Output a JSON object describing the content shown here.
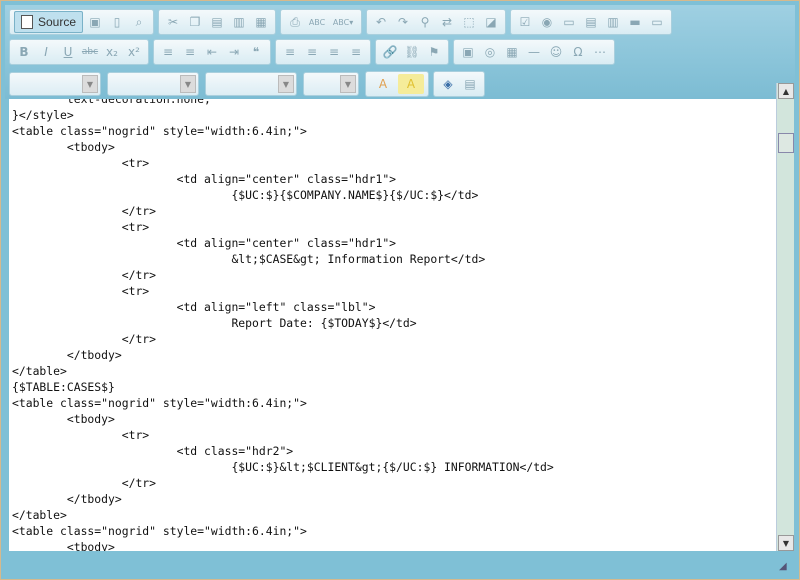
{
  "toolbar": {
    "source_label": "Source",
    "row1_icons": [
      "save-icon",
      "new-page-icon",
      "preview-icon",
      "cut-icon",
      "copy-icon",
      "paste-icon",
      "paste-text-icon",
      "paste-word-icon",
      "print-icon",
      "spellcheck-icon",
      "spellcheck-dropdown-icon",
      "undo-icon",
      "redo-icon",
      "find-icon",
      "replace-icon",
      "select-all-icon",
      "remove-format-icon",
      "checkbox-icon",
      "radio-icon",
      "textfield-icon",
      "textarea-icon",
      "select-icon",
      "button-icon",
      "imagebutton-icon"
    ],
    "row2_icons": [
      "bold-icon",
      "italic-icon",
      "underline-icon",
      "strike-icon",
      "subscript-icon",
      "superscript-icon",
      "ordered-list-icon",
      "unordered-list-icon",
      "outdent-icon",
      "indent-icon",
      "blockquote-icon",
      "align-left-icon",
      "align-center-icon",
      "align-right-icon",
      "justify-icon",
      "link-icon",
      "unlink-icon",
      "anchor-icon",
      "image-icon",
      "flash-icon",
      "table-icon",
      "hr-icon",
      "smiley-icon",
      "special-char-icon",
      "pagebreak-icon"
    ],
    "row2_glyphs": [
      "B",
      "I",
      "U",
      "abc",
      "x₂",
      "x²",
      "≡",
      "≡",
      "⇤",
      "⇥",
      "❝",
      "≡",
      "≡",
      "≡",
      "≡",
      "🔗",
      "⛓",
      "⚑",
      "▣",
      "◎",
      "▦",
      "—",
      "☺",
      "Ω",
      "⋯"
    ],
    "row3_icons": [
      "text-color-icon",
      "bg-color-icon",
      "maximize-icon",
      "show-blocks-icon"
    ],
    "row3_glyphs": [
      "A",
      "A",
      "◈",
      "▤"
    ]
  },
  "editor": {
    "lines": [
      "        text-decoration:none;",
      "}</style>",
      "<table class=\"nogrid\" style=\"width:6.4in;\">",
      "        <tbody>",
      "                <tr>",
      "                        <td align=\"center\" class=\"hdr1\">",
      "                                {$UC:$}{$COMPANY.NAME$}{$/UC:$}</td>",
      "                </tr>",
      "                <tr>",
      "                        <td align=\"center\" class=\"hdr1\">",
      "                                &lt;$CASE&gt; Information Report</td>",
      "                </tr>",
      "                <tr>",
      "                        <td align=\"left\" class=\"lbl\">",
      "                                Report Date: {$TODAY$}</td>",
      "                </tr>",
      "        </tbody>",
      "</table>",
      "{$TABLE:CASES$}",
      "<table class=\"nogrid\" style=\"width:6.4in;\">",
      "        <tbody>",
      "                <tr>",
      "                        <td class=\"hdr2\">",
      "                                {$UC:$}&lt;$CLIENT&gt;{$/UC:$} INFORMATION</td>",
      "                </tr>",
      "        </tbody>",
      "</table>",
      "<table class=\"nogrid\" style=\"width:6.4in;\">",
      "        <tbody>"
    ]
  }
}
